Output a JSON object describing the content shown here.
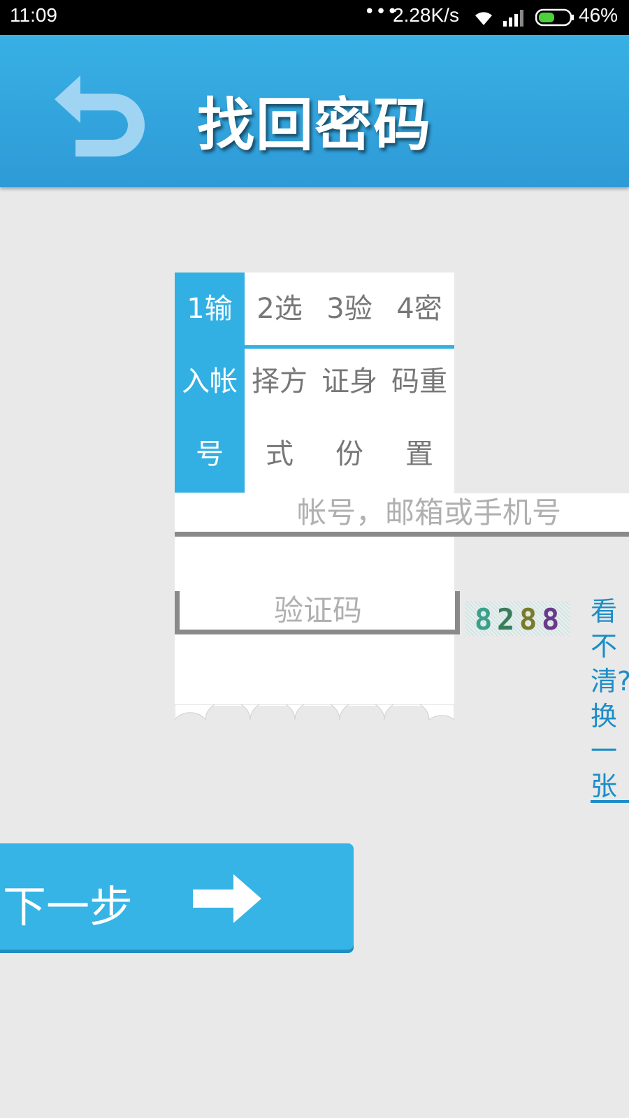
{
  "status_bar": {
    "time": "11:09",
    "dots": "•••",
    "speed": "2.28K/s",
    "battery": "46%"
  },
  "header": {
    "title": "找回密码"
  },
  "steps": [
    {
      "label": "1输入帐号",
      "active": true
    },
    {
      "label": "2选择方式",
      "active": false
    },
    {
      "label": "3验证身份",
      "active": false
    },
    {
      "label": "4密码重置",
      "active": false
    }
  ],
  "form": {
    "account_placeholder": "帐号，邮箱或手机号",
    "captcha_placeholder": "验证码",
    "captcha_code": [
      "8",
      "2",
      "8",
      "8"
    ],
    "captcha_colors": [
      "#3aa08a",
      "#3a7c5c",
      "#7a7a2a",
      "#6a3a8a"
    ],
    "refresh_label": "看不清?换一张"
  },
  "next_button": {
    "label": "下一步"
  },
  "colors": {
    "primary": "#33b0e3",
    "link": "#1d8dc7"
  }
}
